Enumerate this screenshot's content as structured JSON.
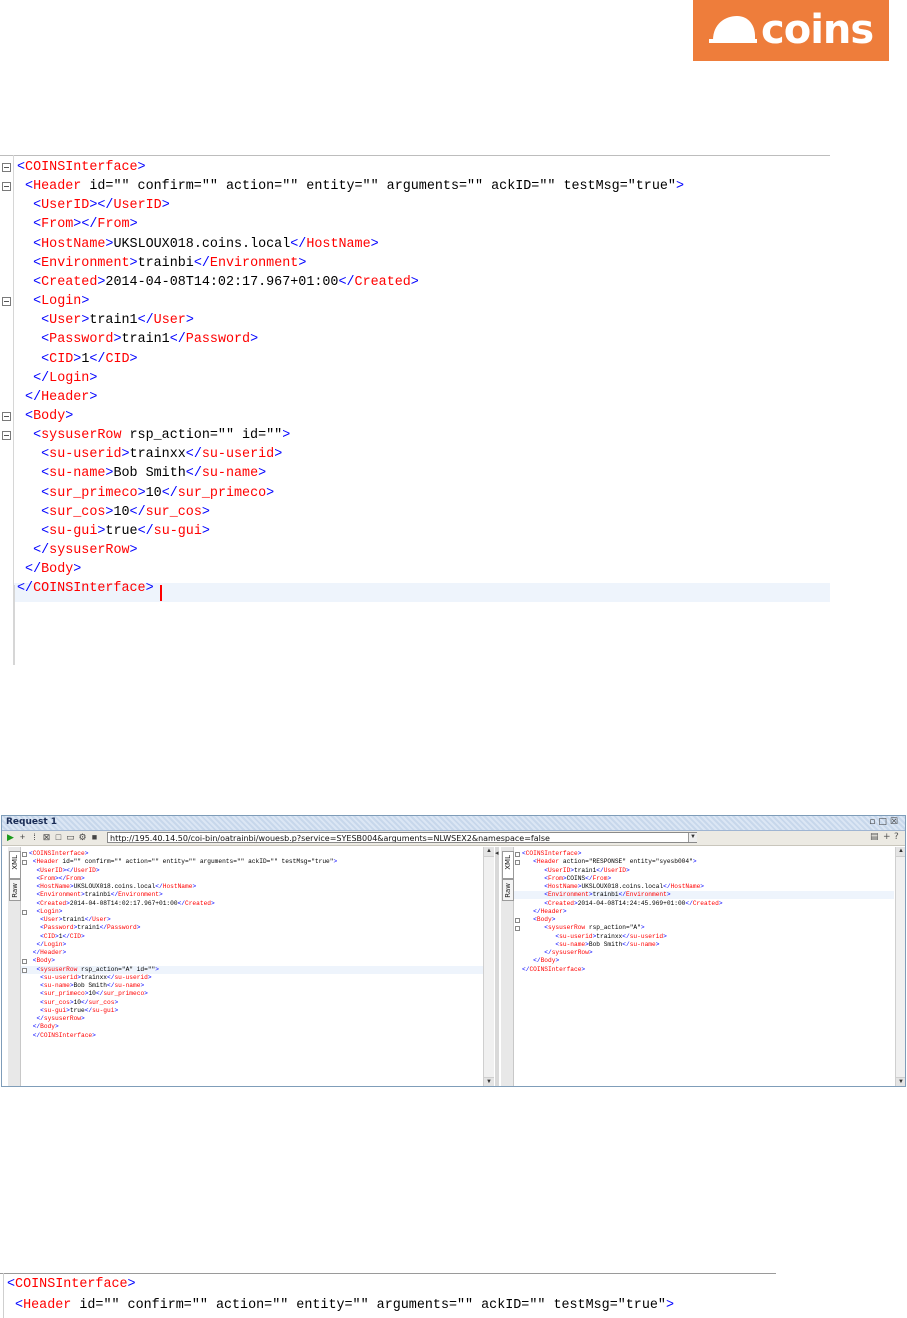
{
  "logo": {
    "text": "coins",
    "brand_color": "#ee7d3b"
  },
  "colors": {
    "tag": "#ff0000",
    "bracket": "#0000ff",
    "attribute": "#008080",
    "value": "#a000a0",
    "text": "#000000",
    "current_line": "#eef4fc"
  },
  "window": {
    "title": "Request 1",
    "url": "http://195.40.14.50/coi-bin/oatrainbi/wouesb.p?service=SYESB004&arguments=NLWSEX2&namespace=false",
    "side_tabs": [
      "XML",
      "Raw"
    ],
    "request_lines": [
      "<COINSInterface>",
      " <Header id=\"\" confirm=\"\" action=\"\" entity=\"\" arguments=\"\" ackID=\"\" testMsg=\"true\">",
      "  <UserID></UserID>",
      "  <From></From>",
      "  <HostName>UKSLOUX018.coins.local</HostName>",
      "  <Environment>trainbi</Environment>",
      "  <Created>2014-04-08T14:02:17.967+01:00</Created>",
      "  <Login>",
      "   <User>train1</User>",
      "   <Password>train1</Password>",
      "   <CID>1</CID>",
      "  </Login>",
      " </Header>",
      " <Body>",
      "  <sysuserRow rsp_action=\"A\" id=\"\">",
      "   <su-userid>trainxx</su-userid>",
      "   <su-name>Bob Smith</su-name>",
      "   <sur_primeco>10</sur_primeco>",
      "   <sur_cos>10</sur_cos>",
      "   <su-gui>true</su-gui>",
      "  </sysuserRow>",
      " </Body>",
      " </COINSInterface>"
    ],
    "response_lines": [
      "<COINSInterface>",
      "   <Header action=\"RESPONSE\" entity=\"syesb004\">",
      "      <UserID>train1</UserID>",
      "      <From>COINS</From>",
      "      <HostName>UKSLOUX018.coins.local</HostName>",
      "      <Environment>trainbi</Environment>",
      "      <Created>2014-04-08T14:24:45.969+01:00</Created>",
      "   </Header>",
      "   <Body>",
      "      <sysuserRow rsp_action=\"A\">",
      "         <su-userid>trainxx</su-userid>",
      "         <su-name>Bob Smith</su-name>",
      "      </sysuserRow>",
      "   </Body>",
      "</COINSInterface>"
    ]
  },
  "editor": {
    "lines": [
      "<COINSInterface>",
      " <Header id=\"\" confirm=\"\" action=\"\" entity=\"\" arguments=\"\" ackID=\"\" testMsg=\"true\">",
      "  <UserID></UserID>",
      "  <From></From>",
      "  <HostName>UKSLOUX018.coins.local</HostName>",
      "  <Environment>trainbi</Environment>",
      "  <Created>2014-04-08T14:02:17.967+01:00</Created>",
      "  <Login>",
      "   <User>train1</User>",
      "   <Password>train1</Password>",
      "   <CID>1</CID>",
      "  </Login>",
      " </Header>",
      " <Body>",
      "  <sysuserRow rsp_action=\"\" id=\"\">",
      "   <su-userid>trainxx</su-userid>",
      "   <su-name>Bob Smith</su-name>",
      "   <sur_primeco>10</sur_primeco>",
      "   <sur_cos>10</sur_cos>",
      "   <su-gui>true</su-gui>",
      "  </sysuserRow>",
      " </Body>",
      "</COINSInterface>"
    ]
  },
  "editor_bottom": {
    "lines": [
      "<COINSInterface>",
      " <Header id=\"\" confirm=\"\" action=\"\" entity=\"\" arguments=\"\" ackID=\"\" testMsg=\"true\">"
    ]
  }
}
